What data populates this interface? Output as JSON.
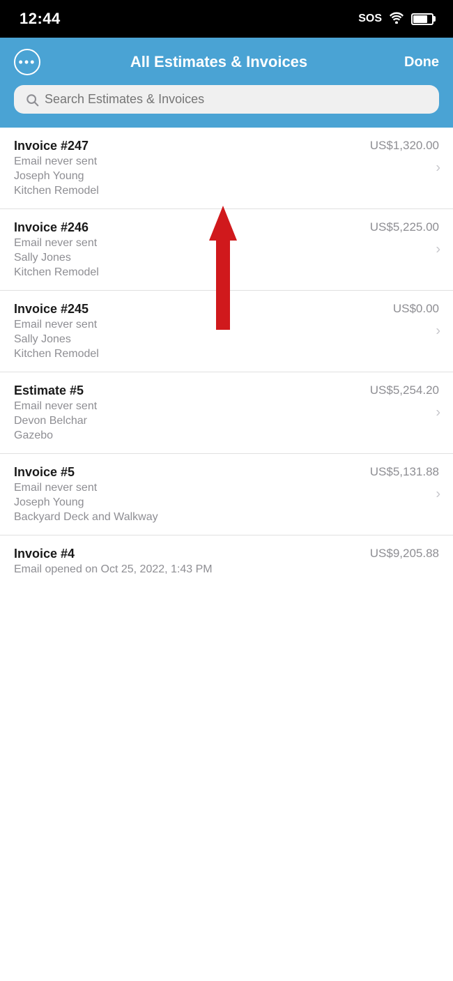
{
  "statusBar": {
    "time": "12:44",
    "sos": "SOS",
    "wifi": "wifi",
    "battery": "battery"
  },
  "header": {
    "title": "All Estimates & Invoices",
    "moreButton": "•••",
    "doneButton": "Done",
    "searchPlaceholder": "Search Estimates & Invoices"
  },
  "invoices": [
    {
      "id": "invoice-247",
      "title": "Invoice #247",
      "amount": "US$1,320.00",
      "status": "Email never sent",
      "client": "Joseph Young",
      "project": "Kitchen Remodel"
    },
    {
      "id": "invoice-246",
      "title": "Invoice #246",
      "amount": "US$5,225.00",
      "status": "Email never sent",
      "client": "Sally Jones",
      "project": "Kitchen Remodel"
    },
    {
      "id": "invoice-245",
      "title": "Invoice #245",
      "amount": "US$0.00",
      "status": "Email never sent",
      "client": "Sally Jones",
      "project": "Kitchen Remodel"
    },
    {
      "id": "estimate-5",
      "title": "Estimate #5",
      "amount": "US$5,254.20",
      "status": "Email never sent",
      "client": "Devon Belchar",
      "project": "Gazebo"
    },
    {
      "id": "invoice-5",
      "title": "Invoice #5",
      "amount": "US$5,131.88",
      "status": "Email never sent",
      "client": "Joseph Young",
      "project": "Backyard Deck and Walkway"
    },
    {
      "id": "invoice-4",
      "title": "Invoice #4",
      "amount": "US$9,205.88",
      "status": "Email opened on Oct 25, 2022, 1:43 PM",
      "client": "",
      "project": ""
    }
  ]
}
